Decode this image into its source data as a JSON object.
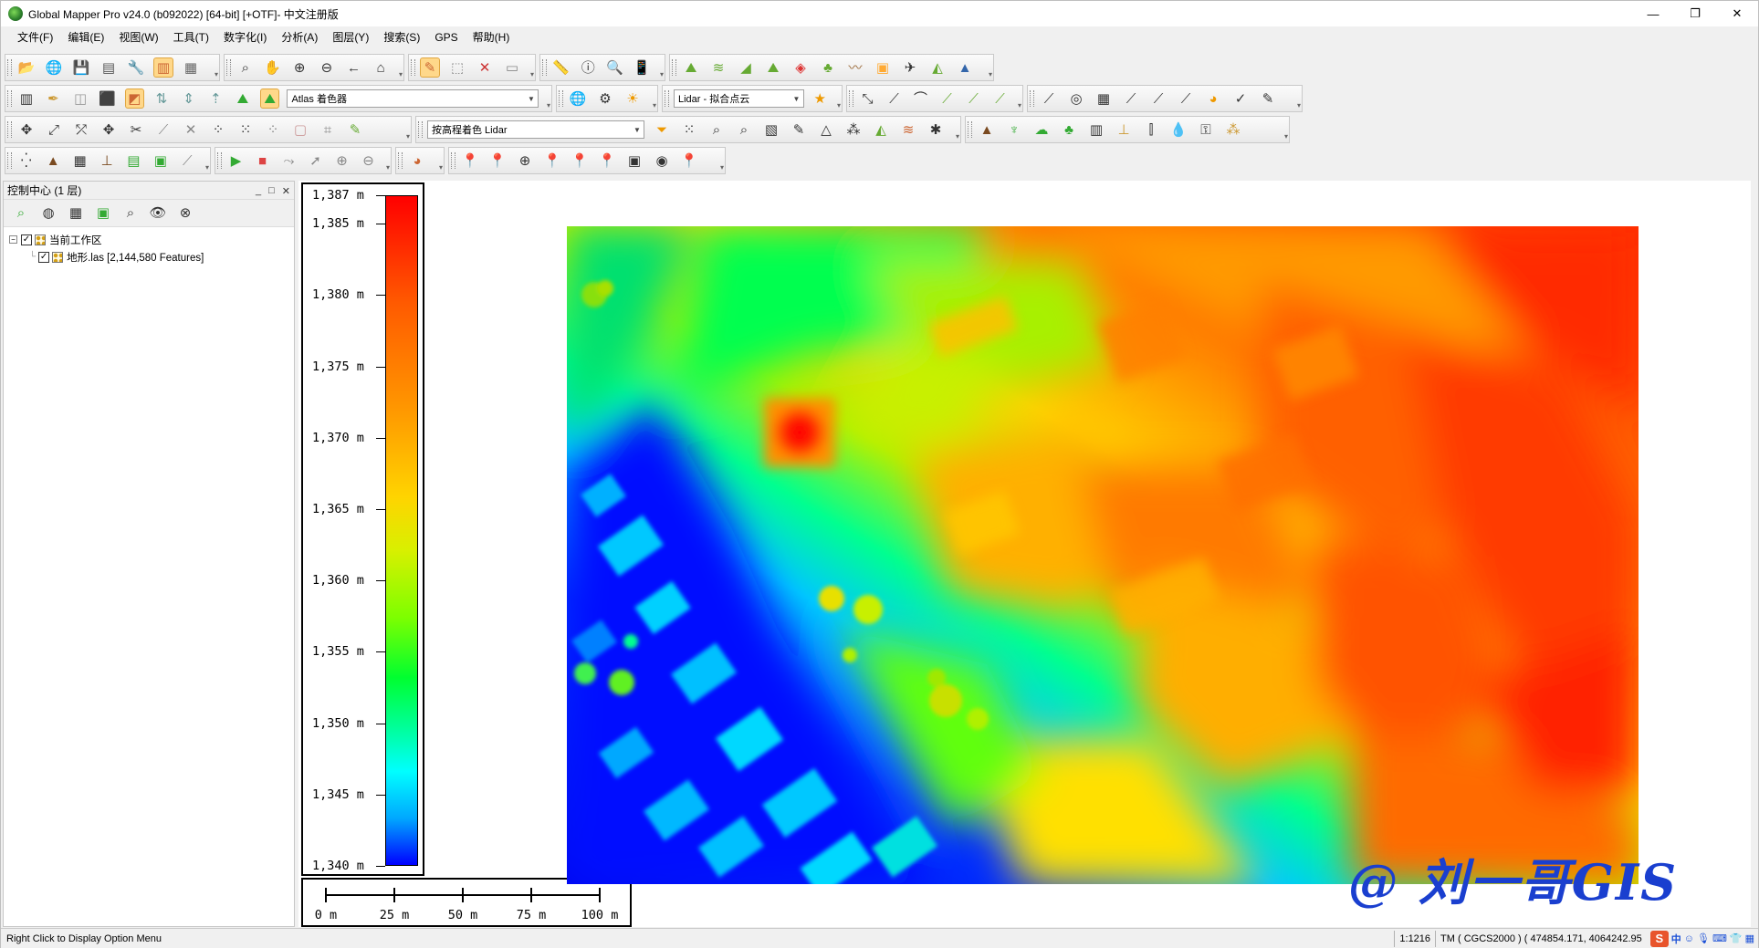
{
  "window": {
    "title": "Global Mapper Pro v24.0 (b092022) [64-bit] [+OTF]- 中文注册版",
    "controls": {
      "minimize": "—",
      "maximize": "❐",
      "close": "✕"
    }
  },
  "menu": [
    "文件(F)",
    "编辑(E)",
    "视图(W)",
    "工具(T)",
    "数字化(I)",
    "分析(A)",
    "图层(Y)",
    "搜索(S)",
    "GPS",
    "帮助(H)"
  ],
  "toolbars": {
    "shader_combo": "Atlas 着色器",
    "lidar_combo": "Lidar - 拟合点云",
    "color_mode_combo": "按高程着色 Lidar"
  },
  "control_center": {
    "title": "控制中心 (1 层)",
    "header_buttons": [
      "_",
      "□",
      "✕"
    ],
    "tree": [
      {
        "label": "当前工作区",
        "checked": true,
        "expander": "−"
      },
      {
        "label": "地形.las [2,144,580 Features]",
        "checked": true
      }
    ]
  },
  "legend": {
    "ticks": [
      {
        "label": "1,387  m",
        "value": 1387
      },
      {
        "label": "1,385  m",
        "value": 1385
      },
      {
        "label": "1,380  m",
        "value": 1380
      },
      {
        "label": "1,375  m",
        "value": 1375
      },
      {
        "label": "1,370  m",
        "value": 1370
      },
      {
        "label": "1,365  m",
        "value": 1365
      },
      {
        "label": "1,360  m",
        "value": 1360
      },
      {
        "label": "1,355  m",
        "value": 1355
      },
      {
        "label": "1,350  m",
        "value": 1350
      },
      {
        "label": "1,345  m",
        "value": 1345
      },
      {
        "label": "1,340  m",
        "value": 1340
      }
    ],
    "min": 1340,
    "max": 1387,
    "colors": [
      "#ff0000",
      "#ff9800",
      "#ffd400",
      "#7dff00",
      "#00ff30",
      "#00ffff",
      "#0000ff"
    ]
  },
  "scale_bar": {
    "labels": [
      "0  m",
      "25  m",
      "50  m",
      "75  m",
      "100  m"
    ],
    "values": [
      0,
      25,
      50,
      75,
      100
    ]
  },
  "watermark": "@ 刘一哥GIS",
  "status": {
    "hint": "Right Click to Display Option Menu",
    "scale": "1:1216",
    "projection": "TM ( CGCS2000 ) ( 474854.171, 4064242.95",
    "tray_logo": "S",
    "tray_lang": "中"
  }
}
